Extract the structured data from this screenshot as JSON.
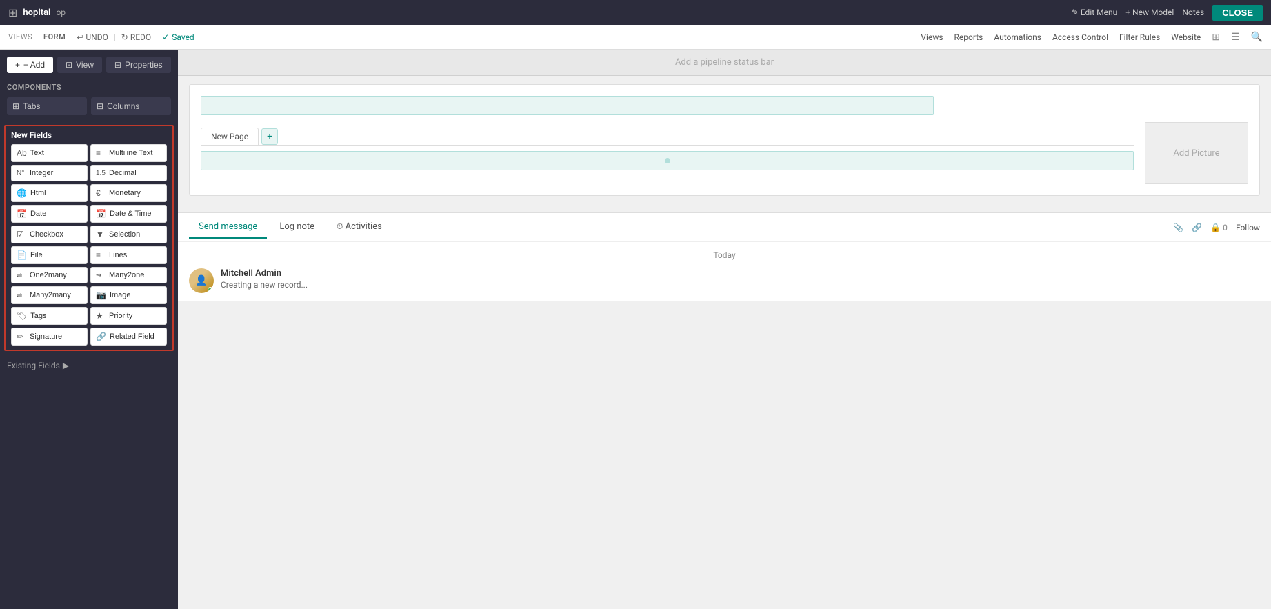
{
  "topbar": {
    "app_name": "hopital",
    "op": "op",
    "edit_menu": "Edit Menu",
    "new_model": "+ New Model",
    "notes": "Notes",
    "close": "CLOSE"
  },
  "secondbar": {
    "views_label": "VIEWS",
    "form_label": "FORM",
    "undo": "UNDO",
    "redo": "REDO",
    "saved": "Saved",
    "nav_links": [
      "Views",
      "Reports",
      "Automations",
      "Access Control",
      "Filter Rules",
      "Website"
    ]
  },
  "sidebar": {
    "add_btn": "+ Add",
    "view_btn": "View",
    "properties_btn": "Properties",
    "components_label": "Components",
    "tabs_btn": "Tabs",
    "columns_btn": "Columns",
    "new_fields_label": "New Fields",
    "fields": [
      {
        "icon": "Ab",
        "label": "Text"
      },
      {
        "icon": "≡",
        "label": "Multiline Text"
      },
      {
        "icon": "N°",
        "label": "Integer"
      },
      {
        "icon": "1.5",
        "label": "Decimal"
      },
      {
        "icon": "🌐",
        "label": "Html"
      },
      {
        "icon": "€",
        "label": "Monetary"
      },
      {
        "icon": "📅",
        "label": "Date"
      },
      {
        "icon": "📅",
        "label": "Date & Time"
      },
      {
        "icon": "☑",
        "label": "Checkbox"
      },
      {
        "icon": "▼",
        "label": "Selection"
      },
      {
        "icon": "📄",
        "label": "File"
      },
      {
        "icon": "≡",
        "label": "Lines"
      },
      {
        "icon": "⇌",
        "label": "One2many"
      },
      {
        "icon": "⇝",
        "label": "Many2one"
      },
      {
        "icon": "⇌",
        "label": "Many2many"
      },
      {
        "icon": "📷",
        "label": "Image"
      },
      {
        "icon": "🏷",
        "label": "Tags"
      },
      {
        "icon": "★",
        "label": "Priority"
      },
      {
        "icon": "✏",
        "label": "Signature"
      },
      {
        "icon": "🔗",
        "label": "Related Field"
      }
    ],
    "existing_fields": "Existing Fields"
  },
  "canvas": {
    "pipeline_bar": "Add a pipeline status bar",
    "add_picture": "Add Picture",
    "new_page_tab": "New Page"
  },
  "chatter": {
    "send_message_tab": "Send message",
    "log_note_tab": "Log note",
    "activities_tab": "Activities",
    "today_label": "Today",
    "message_author": "Mitchell Admin",
    "message_text": "Creating a new record...",
    "follow_btn": "Follow"
  }
}
